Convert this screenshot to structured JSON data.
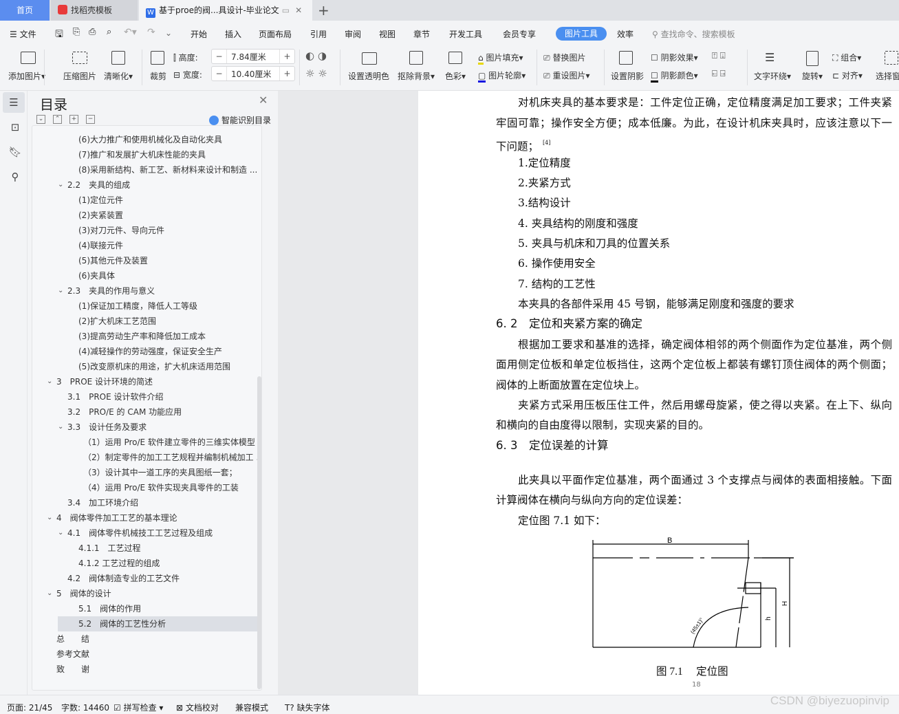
{
  "tabs": [
    {
      "label": "首页"
    },
    {
      "label": "找稻壳模板"
    },
    {
      "label": "基于proe的阀...具设计-毕业论文"
    }
  ],
  "menu": {
    "file": "文件",
    "items": [
      "开始",
      "插入",
      "页面布局",
      "引用",
      "审阅",
      "视图",
      "章节",
      "开发工具",
      "会员专享"
    ],
    "active": "图片工具",
    "after": "效率",
    "search_placeholder": "查找命令、搜索模板"
  },
  "ribbon": {
    "add_picture": "添加图片",
    "compress": "压缩图片",
    "sharpen": "清晰化",
    "crop": "裁剪",
    "height_label": "高度:",
    "height_value": "7.84厘米",
    "width_label": "宽度:",
    "width_value": "10.40厘米",
    "transparent": "设置透明色",
    "remove_bg": "抠除背景",
    "color": "色彩",
    "fill": "图片填充",
    "outline": "图片轮廓",
    "replace": "替换图片",
    "reset": "重设图片",
    "set_shadow": "设置阴影",
    "shadow_effect": "阴影效果",
    "shadow_color": "阴影颜色",
    "wrap": "文字环绕",
    "rotate": "旋转",
    "group": "组合",
    "align": "对齐",
    "select_pane": "选择窗"
  },
  "toc": {
    "title": "目录",
    "smart": "智能识别目录",
    "items": [
      {
        "text": "(6)大力推广和使用机械化及自动化夹具",
        "level": 4
      },
      {
        "text": "(7)推广和发展扩大机床性能的夹具",
        "level": 4
      },
      {
        "text": "(8)采用新结构、新工艺、新材料来设计和制造 ...",
        "level": 4
      },
      {
        "text": "2.2　夹具的组成",
        "level": 2,
        "expanded": true
      },
      {
        "text": "(1)定位元件",
        "level": 4
      },
      {
        "text": "(2)夹紧装置",
        "level": 4
      },
      {
        "text": "(3)对刀元件、导向元件",
        "level": 4
      },
      {
        "text": "(4)联接元件",
        "level": 4
      },
      {
        "text": "(5)其他元件及装置",
        "level": 4
      },
      {
        "text": "(6)夹具体",
        "level": 4
      },
      {
        "text": "2.3　夹具的作用与意义",
        "level": 2,
        "expanded": true
      },
      {
        "text": "(1)保证加工精度，降低人工等级",
        "level": 4
      },
      {
        "text": "(2)扩大机床工艺范围",
        "level": 4
      },
      {
        "text": "(3)提高劳动生产率和降低加工成本",
        "level": 4
      },
      {
        "text": "(4)减轻操作的劳动强度，保证安全生产",
        "level": 4
      },
      {
        "text": "(5)改变原机床的用途，扩大机床适用范围",
        "level": 4
      },
      {
        "text": "3　PROE 设计环境的简述",
        "level": 1,
        "expanded": true
      },
      {
        "text": "3.1　PROE 设计软件介绍",
        "level": 2
      },
      {
        "text": "3.2　PRO/E 的 CAM 功能应用",
        "level": 2
      },
      {
        "text": "3.3　设计任务及要求",
        "level": 2,
        "expanded": true
      },
      {
        "text": "（1）运用 Pro/E 软件建立零件的三维实体模型 ...",
        "level": 5
      },
      {
        "text": "（2）制定零件的加工工艺规程并编制机械加工 ...",
        "level": 5
      },
      {
        "text": "（3）设计其中一道工序的夹具图纸一套；",
        "level": 5
      },
      {
        "text": "（4）运用 Pro/E 软件实现夹具零件的工装",
        "level": 5
      },
      {
        "text": "3.4　加工环境介绍",
        "level": 2
      },
      {
        "text": "4　阀体零件加工工艺的基本理论",
        "level": 1,
        "expanded": true
      },
      {
        "text": "4.1　阀体零件机械技工工艺过程及组成",
        "level": 2,
        "expanded": true
      },
      {
        "text": "4.1.1　工艺过程",
        "level": 4
      },
      {
        "text": "4.1.2 工艺过程的组成",
        "level": 4
      },
      {
        "text": "4.2　阀体制造专业的工艺文件",
        "level": 2
      },
      {
        "text": "5　阀体的设计",
        "level": 1,
        "expanded": true
      },
      {
        "text": "5.1　阀体的作用",
        "level": 4
      },
      {
        "text": "5.2　阀体的工艺性分析",
        "level": 4,
        "selected": true
      },
      {
        "text": "总　　结",
        "level": 0
      },
      {
        "text": "参考文献",
        "level": 0
      },
      {
        "text": "致　　谢",
        "level": 0
      }
    ]
  },
  "document": {
    "lines": [
      {
        "text": "对机床夹具的基本要求是：工件定位正确，定位精度满足加工要求；工件夹紧",
        "type": "first"
      },
      {
        "text": "牢固可靠；操作安全方便；成本低廉。为此，在设计机床夹具时，应该注意以下一",
        "type": "body"
      },
      {
        "text": "下问题；",
        "type": "last",
        "ref": "[4]"
      },
      {
        "text": "1.定位精度",
        "type": "item"
      },
      {
        "text": "2.夹紧方式",
        "type": "item"
      },
      {
        "text": "3.结构设计",
        "type": "item"
      },
      {
        "text": "4. 夹具结构的刚度和强度",
        "type": "item"
      },
      {
        "text": "5. 夹具与机床和刀具的位置关系",
        "type": "item"
      },
      {
        "text": "6. 操作使用安全",
        "type": "item"
      },
      {
        "text": "7. 结构的工艺性",
        "type": "item"
      },
      {
        "text": "本夹具的各部件采用 45 号钢，能够满足刚度和强度的要求",
        "type": "item"
      },
      {
        "text": "6. 2　定位和夹紧方案的确定",
        "type": "heading"
      },
      {
        "text": "根据加工要求和基准的选择，确定阀体相邻的两个侧面作为定位基准，两个侧",
        "type": "first"
      },
      {
        "text": "面用侧定位板和单定位板挡住，这两个定位板上都装有螺钉顶住阀体的两个侧面；",
        "type": "body"
      },
      {
        "text": "阀体的上断面放置在定位块上。",
        "type": "last"
      },
      {
        "text": "夹紧方式采用压板压住工件，然后用螺母旋紧，使之得以夹紧。在上下、纵向",
        "type": "first"
      },
      {
        "text": "和横向的自由度得以限制，实现夹紧的目的。",
        "type": "last"
      },
      {
        "text": "6. 3　定位误差的计算",
        "type": "heading"
      },
      {
        "text": "此夹具以平面作定位基准，两个面通过 3 个支撑点与阀体的表面相接触。下面",
        "type": "first"
      },
      {
        "text": "计算阀体在横向与纵向方向的定位误差：",
        "type": "last"
      },
      {
        "text": "定位图 7.1 如下：",
        "type": "item"
      }
    ],
    "figure": {
      "label_b": "B",
      "label_h_big": "H",
      "label_h_small": "h",
      "label_angle": "(45±1)°",
      "caption": "图 7.1　 定位图"
    },
    "page_number": "18"
  },
  "status": {
    "page": "页面: 21/45",
    "words": "字数: 14460",
    "spell": "拼写检查",
    "proof": "文档校对",
    "compat": "兼容模式",
    "missing_font": "缺失字体"
  },
  "watermark": "CSDN @biyezuopinvip"
}
